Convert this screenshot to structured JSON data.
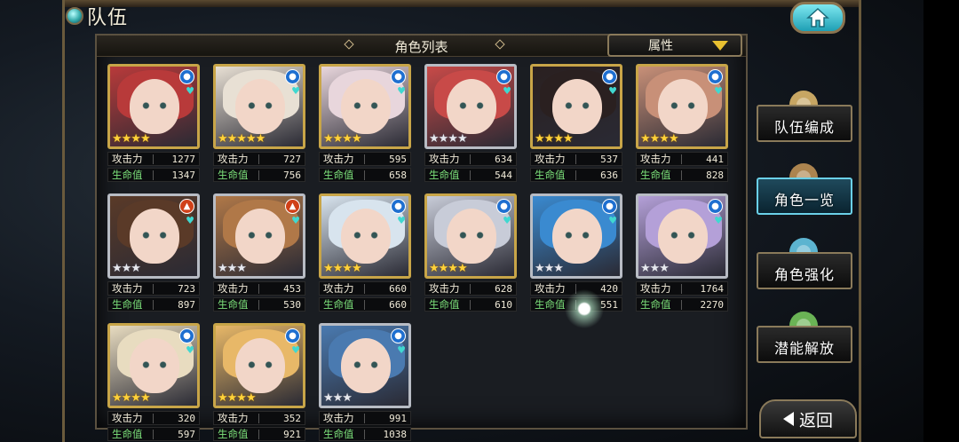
{
  "header": {
    "title": "队伍"
  },
  "panel": {
    "title": "角色列表",
    "filter_label": "属性"
  },
  "stat_labels": {
    "atk": "攻击力",
    "hp": "生命值"
  },
  "characters": [
    {
      "atk": "1277",
      "hp": "1347",
      "rarity": 4,
      "star_color": "gold",
      "element": "water",
      "hair": "#b83a3a"
    },
    {
      "atk": "727",
      "hp": "756",
      "rarity": 5,
      "star_color": "gold",
      "element": "water",
      "hair": "#e8e0d4"
    },
    {
      "atk": "595",
      "hp": "658",
      "rarity": 4,
      "star_color": "gold",
      "element": "water",
      "hair": "#e8d6dc"
    },
    {
      "atk": "634",
      "hp": "544",
      "rarity": 4,
      "star_color": "silver",
      "element": "water",
      "hair": "#c84a48"
    },
    {
      "atk": "537",
      "hp": "636",
      "rarity": 4,
      "star_color": "gold",
      "element": "water",
      "hair": "#2a2020"
    },
    {
      "atk": "441",
      "hp": "828",
      "rarity": 4,
      "star_color": "gold",
      "element": "water",
      "hair": "#c89078"
    },
    {
      "atk": "723",
      "hp": "897",
      "rarity": 3,
      "star_color": "silver",
      "element": "fire",
      "hair": "#5a3a28"
    },
    {
      "atk": "453",
      "hp": "530",
      "rarity": 3,
      "star_color": "silver",
      "element": "fire",
      "hair": "#b07848"
    },
    {
      "atk": "660",
      "hp": "660",
      "rarity": 4,
      "star_color": "gold",
      "element": "water",
      "hair": "#d8e4ee"
    },
    {
      "atk": "628",
      "hp": "610",
      "rarity": 4,
      "star_color": "gold",
      "element": "water",
      "hair": "#c8ccd8"
    },
    {
      "atk": "420",
      "hp": "551",
      "rarity": 3,
      "star_color": "silver",
      "element": "water",
      "hair": "#3a8ad0"
    },
    {
      "atk": "1764",
      "hp": "2270",
      "rarity": 3,
      "star_color": "silver",
      "element": "water",
      "hair": "#b4a0d8"
    },
    {
      "atk": "320",
      "hp": "597",
      "rarity": 4,
      "star_color": "gold",
      "element": "water",
      "hair": "#e8dcc0"
    },
    {
      "atk": "352",
      "hp": "921",
      "rarity": 4,
      "star_color": "gold",
      "element": "water",
      "hair": "#e8b868"
    },
    {
      "atk": "991",
      "hp": "1038",
      "rarity": 3,
      "star_color": "silver",
      "element": "water",
      "hair": "#4a7ab0"
    }
  ],
  "side_menu": [
    {
      "label": "队伍编成",
      "icon": "team-heroes-icon",
      "active": false
    },
    {
      "label": "角色一览",
      "icon": "book-icon",
      "active": true
    },
    {
      "label": "角色强化",
      "icon": "crystal-icon",
      "active": false
    },
    {
      "label": "潜能解放",
      "icon": "eye-orb-icon",
      "active": false
    }
  ],
  "back": {
    "label": "返回"
  },
  "home": {
    "icon": "home-icon"
  }
}
